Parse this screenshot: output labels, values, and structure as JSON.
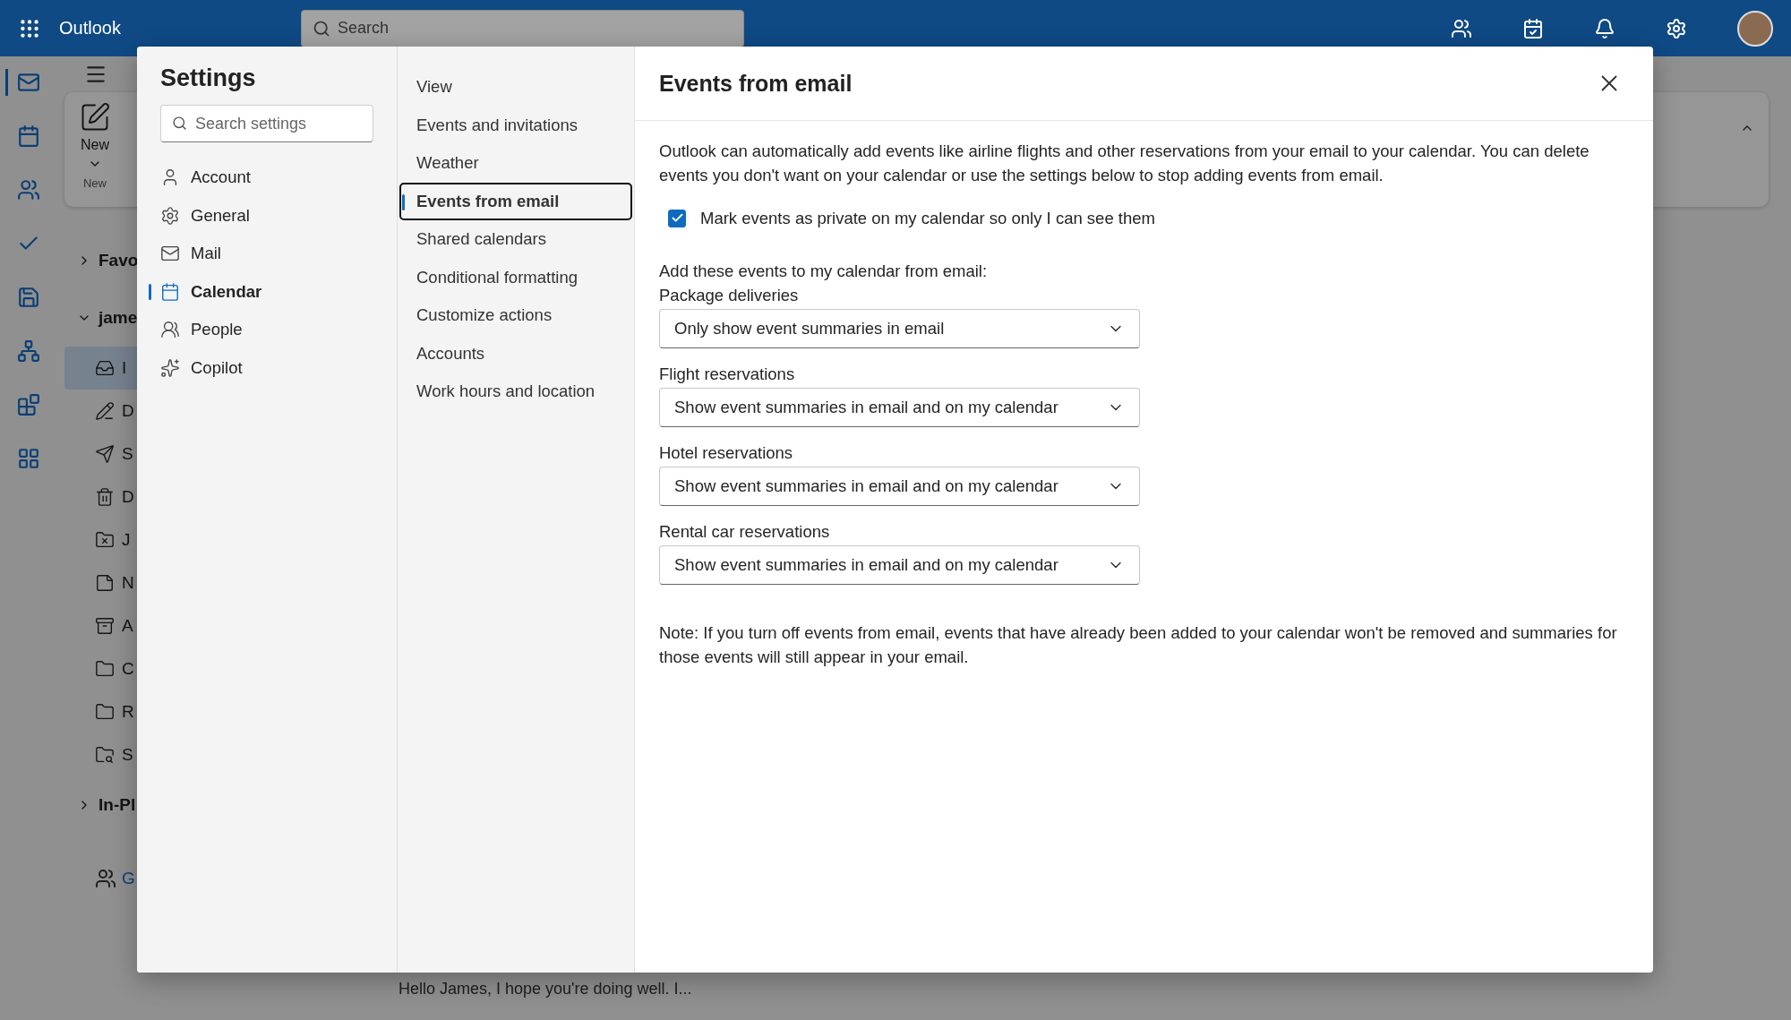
{
  "top_bar": {
    "app_name": "Outlook",
    "search": {
      "placeholder": "Search"
    }
  },
  "rail_items": [
    {
      "kind": "mail",
      "selected": true
    },
    {
      "kind": "calendar",
      "selected": false
    },
    {
      "kind": "people",
      "selected": false
    },
    {
      "kind": "todo",
      "selected": false
    },
    {
      "kind": "files",
      "selected": false
    },
    {
      "kind": "org",
      "selected": false
    },
    {
      "kind": "app",
      "selected": false
    },
    {
      "kind": "apps",
      "selected": false
    }
  ],
  "ribbon": {
    "new_button": "New",
    "group_label": "New"
  },
  "folder_pane": {
    "sections": [
      {
        "label": "Favo",
        "expanded": false
      },
      {
        "label": "jame",
        "expanded": true,
        "folders": [
          {
            "kind": "inbox",
            "label": "I",
            "selected": true
          },
          {
            "kind": "drafts",
            "label": "D",
            "selected": false
          },
          {
            "kind": "sent",
            "label": "S",
            "selected": false
          },
          {
            "kind": "deleted",
            "label": "D",
            "selected": false
          },
          {
            "kind": "junk",
            "label": "J",
            "selected": false
          },
          {
            "kind": "notes",
            "label": "N",
            "selected": false
          },
          {
            "kind": "archive",
            "label": "A",
            "selected": false
          },
          {
            "kind": "folder",
            "label": "C",
            "selected": false
          },
          {
            "kind": "folder",
            "label": "R",
            "selected": false
          },
          {
            "kind": "search",
            "label": "S",
            "selected": false
          }
        ]
      },
      {
        "label": "In-Pl",
        "expanded": false
      }
    ],
    "groups_link": "G"
  },
  "message_list": {
    "preview": "Hello James, I hope you're doing well. I..."
  },
  "settings": {
    "title": "Settings",
    "search": {
      "placeholder": "Search settings"
    },
    "categories": [
      {
        "kind": "account",
        "label": "Account",
        "selected": false
      },
      {
        "kind": "general",
        "label": "General",
        "selected": false
      },
      {
        "kind": "mail",
        "label": "Mail",
        "selected": false
      },
      {
        "kind": "calendar",
        "label": "Calendar",
        "selected": true
      },
      {
        "kind": "people",
        "label": "People",
        "selected": false
      },
      {
        "kind": "copilot",
        "label": "Copilot",
        "selected": false
      }
    ],
    "subcategories": [
      {
        "label": "View",
        "selected": false
      },
      {
        "label": "Events and invitations",
        "selected": false
      },
      {
        "label": "Weather",
        "selected": false
      },
      {
        "label": "Events from email",
        "selected": true
      },
      {
        "label": "Shared calendars",
        "selected": false
      },
      {
        "label": "Conditional formatting",
        "selected": false
      },
      {
        "label": "Customize actions",
        "selected": false
      },
      {
        "label": "Accounts",
        "selected": false
      },
      {
        "label": "Work hours and location",
        "selected": false
      }
    ],
    "panel": {
      "title": "Events from email",
      "intro": "Outlook can automatically add events like airline flights and other reservations from your email to your calendar. You can delete events you don't want on your calendar or use the settings below to stop adding events from email.",
      "private_checkbox": {
        "label": "Mark events as private on my calendar so only I can see them",
        "checked": true
      },
      "add_label": "Add these events to my calendar from email:",
      "dropdowns": [
        {
          "label": "Package deliveries",
          "value": "Only show event summaries in email"
        },
        {
          "label": "Flight reservations",
          "value": "Show event summaries in email and on my calendar"
        },
        {
          "label": "Hotel reservations",
          "value": "Show event summaries in email and on my calendar"
        },
        {
          "label": "Rental car reservations",
          "value": "Show event summaries in email and on my calendar"
        }
      ],
      "note": "Note: If you turn off events from email, events that have already been added to your calendar won't be removed and summaries for those events will still appear in your email."
    }
  }
}
